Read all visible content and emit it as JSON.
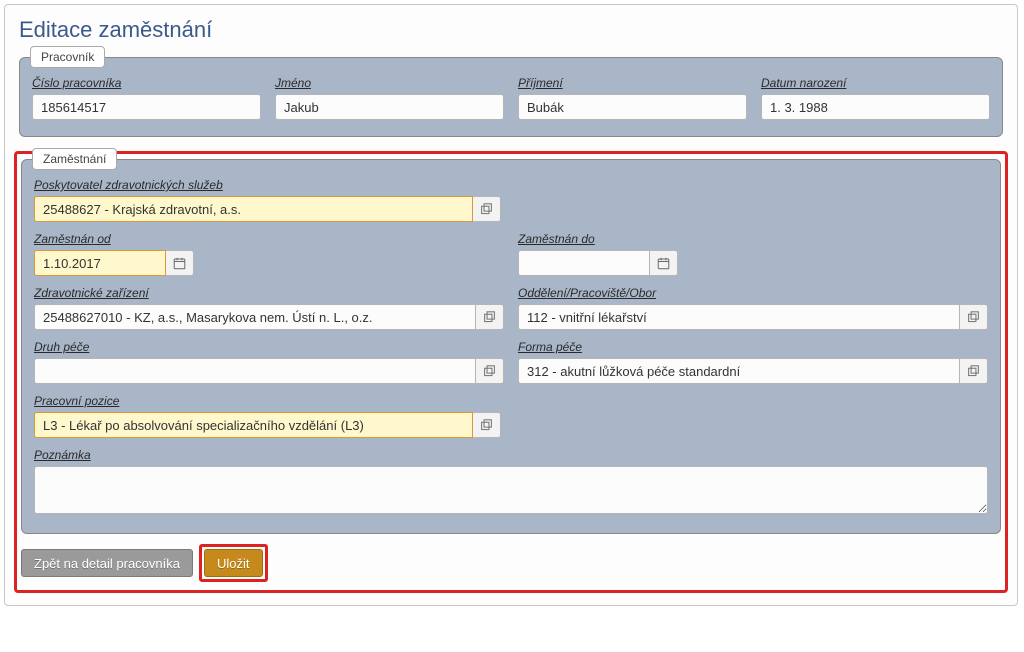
{
  "page": {
    "title": "Editace zaměstnání"
  },
  "employee_section": {
    "legend": "Pracovník",
    "id_label": "Číslo pracovníka",
    "id_value": "185614517",
    "firstname_label": "Jméno",
    "firstname_value": "Jakub",
    "lastname_label": "Příjmení",
    "lastname_value": "Bubák",
    "birthdate_label": "Datum narození",
    "birthdate_value": "1. 3. 1988"
  },
  "employment_section": {
    "legend": "Zaměstnání",
    "provider_label": "Poskytovatel zdravotnických služeb",
    "provider_value": "25488627 - Krajská zdravotní, a.s.",
    "employed_from_label": "Zaměstnán od",
    "employed_from_value": "1.10.2017",
    "employed_to_label": "Zaměstnán do",
    "employed_to_value": "",
    "facility_label": "Zdravotnické zařízení",
    "facility_value": "25488627010 - KZ, a.s., Masarykova nem. Ústí n. L., o.z.",
    "department_label": "Oddělení/Pracoviště/Obor",
    "department_value": "112 - vnitřní lékařství",
    "care_type_label": "Druh péče",
    "care_type_value": "",
    "care_form_label": "Forma péče",
    "care_form_value": "312 - akutní lůžková péče standardní",
    "position_label": "Pracovní pozice",
    "position_value": "L3 - Lékař po absolvování specializačního vzdělání (L3)",
    "note_label": "Poznámka",
    "note_value": ""
  },
  "actions": {
    "back_label": "Zpět na detail pracovníka",
    "save_label": "Uložit"
  }
}
